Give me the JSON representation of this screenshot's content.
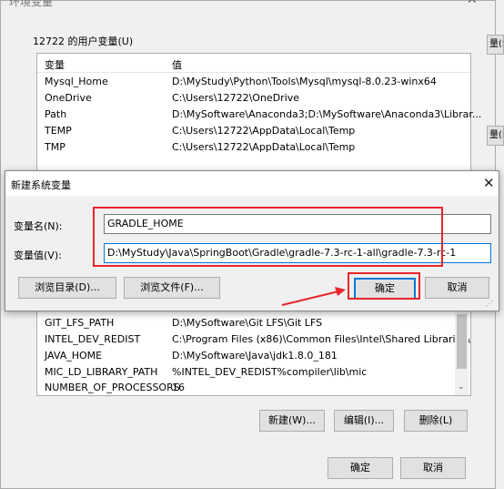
{
  "env_dialog": {
    "title": "环境变量",
    "close_glyph": "✕",
    "user_group_label": "12722 的用户变量(U)",
    "user_vars": {
      "col_name": "变量",
      "col_value": "值",
      "rows": [
        {
          "name": "Mysql_Home",
          "value": "D:\\MyStudy\\Python\\Tools\\Mysql\\mysql-8.0.23-winx64"
        },
        {
          "name": "OneDrive",
          "value": "C:\\Users\\12722\\OneDrive"
        },
        {
          "name": "Path",
          "value": "D:\\MySoftware\\Anaconda3;D:\\MySoftware\\Anaconda3\\Librar..."
        },
        {
          "name": "TEMP",
          "value": "C:\\Users\\12722\\AppData\\Local\\Temp"
        },
        {
          "name": "TMP",
          "value": "C:\\Users\\12722\\AppData\\Local\\Temp"
        }
      ]
    },
    "system_vars": {
      "rows": [
        {
          "name": "GIT_LFS_PATH",
          "value": "D:\\MySoftware\\Git LFS\\Git LFS"
        },
        {
          "name": "INTEL_DEV_REDIST",
          "value": "C:\\Program Files (x86)\\Common Files\\Intel\\Shared Libraries\\"
        },
        {
          "name": "JAVA_HOME",
          "value": "D:\\MySoftware\\Java\\jdk1.8.0_181"
        },
        {
          "name": "MIC_LD_LIBRARY_PATH",
          "value": "%INTEL_DEV_REDIST%compiler\\lib\\mic"
        },
        {
          "name": "NUMBER_OF_PROCESSORS",
          "value": "16"
        }
      ],
      "new_button": "新建(W)...",
      "edit_button": "编辑(I)...",
      "delete_button": "删除(L)"
    },
    "ok_button": "确定",
    "cancel_button": "取消"
  },
  "background": {
    "left_tab_text": "文",
    "left_text_1": "固",
    "left_text_2": "速",
    "right_btn_1": "量(S",
    "right_btn_2": "量(E"
  },
  "new_var_dialog": {
    "title": "新建系统变量",
    "close_glyph": "✕",
    "name_label": "变量名(N):",
    "name_value": "GRADLE_HOME",
    "value_label": "变量值(V):",
    "value_value": "D:\\MyStudy\\Java\\SpringBoot\\Gradle\\gradle-7.3-rc-1-all\\gradle-7.3-rc-1",
    "browse_dir_button": "浏览目录(D)...",
    "browse_file_button": "浏览文件(F)...",
    "ok_button": "确定",
    "cancel_button": "取消"
  },
  "colors": {
    "highlight_red": "#e8262b",
    "focus_blue": "#0078d7"
  }
}
